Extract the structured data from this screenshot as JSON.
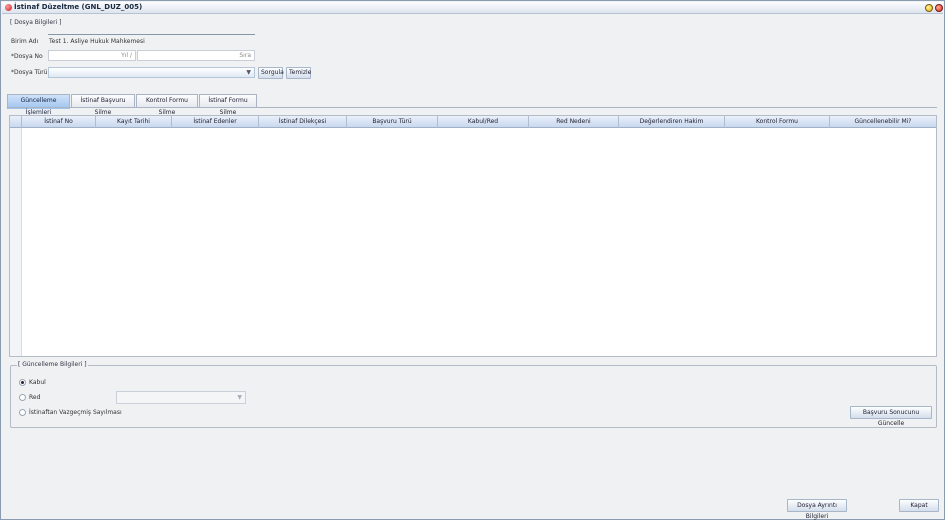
{
  "window": {
    "title": "İstinaf Düzeltme (GNL_DUZ_005)"
  },
  "dosya_bilgileri": {
    "legend": "[ Dosya Bilgileri ]",
    "birim_label": "Birim Adı",
    "birim_value": "Test 1. Asliye Hukuk Mahkemesi",
    "dosya_no_label": "*Dosya No",
    "yil_placeholder": "Yıl /",
    "sira_placeholder": "Sıra",
    "dosya_turu_label": "*Dosya Türü",
    "dosya_turu_value": "",
    "sorgula_label": "Sorgula",
    "temizle_label": "Temizle"
  },
  "tabs": [
    {
      "label": "Güncelleme İşlemleri"
    },
    {
      "label": "İstinaf Başvuru Silme"
    },
    {
      "label": "Kontrol Formu Silme"
    },
    {
      "label": "İstinaf Formu Silme"
    }
  ],
  "table": {
    "columns": [
      "İstinaf No",
      "Kayıt Tarihi",
      "İstinaf Edenler",
      "İstinaf Dilekçesi",
      "Başvuru Türü",
      "Kabul/Red",
      "Red Nedeni",
      "Değerlendiren Hakim",
      "Kontrol Formu",
      "Güncellenebilir Mi?"
    ],
    "rows": []
  },
  "guncelleme_bilgileri": {
    "legend": "[ Güncelleme Bilgileri ]",
    "options": [
      {
        "label": "Kabul",
        "checked": true
      },
      {
        "label": "Red",
        "checked": false
      },
      {
        "label": "İstinaftan Vazgeçmiş Sayılması",
        "checked": false
      }
    ],
    "red_nedeni_value": "",
    "update_button_label": "Başvuru Sonucunu Güncelle"
  },
  "footer": {
    "dosya_ayrinti_label": "Dosya Ayrıntı Bilgileri",
    "kapat_label": "Kapat"
  }
}
